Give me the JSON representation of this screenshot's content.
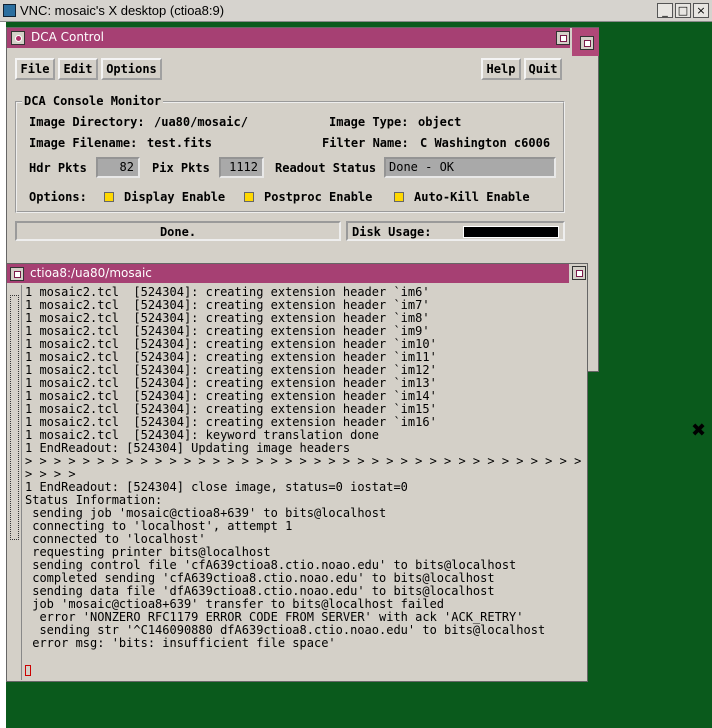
{
  "vnc": {
    "title": "VNC: mosaic's X desktop (ctioa8:9)",
    "minimize": "_",
    "maximize": "□",
    "close": "×"
  },
  "dca": {
    "title": "DCA Control",
    "menu": {
      "file": "File",
      "edit": "Edit",
      "options": "Options"
    },
    "help": "Help",
    "quit": "Quit",
    "monitor_title": "DCA Console Monitor",
    "image_directory_label": "Image Directory:",
    "image_directory": "/ua80/mosaic/",
    "image_type_label": "Image Type:",
    "image_type": "object",
    "image_filename_label": "Image Filename:",
    "image_filename": "test.fits",
    "filter_name_label": "Filter Name:",
    "filter_name": "C Washington c6006",
    "hdr_pkts_label": "Hdr Pkts",
    "hdr_pkts": "82",
    "pix_pkts_label": "Pix Pkts",
    "pix_pkts": "1112",
    "readout_status_label": "Readout Status",
    "readout_status": "Done - OK",
    "options_label": "Options:",
    "display_enable": "Display Enable",
    "postproc_enable": "Postproc Enable",
    "autokill_enable": "Auto-Kill Enable",
    "status": "Done.",
    "disk_usage_label": "Disk Usage:",
    "disk_usage_fraction": 1.0
  },
  "terminal": {
    "title": "ctioa8:/ua80/mosaic",
    "lines": [
      "1 mosaic2.tcl  [524304]: creating extension header `im6'",
      "1 mosaic2.tcl  [524304]: creating extension header `im7'",
      "1 mosaic2.tcl  [524304]: creating extension header `im8'",
      "1 mosaic2.tcl  [524304]: creating extension header `im9'",
      "1 mosaic2.tcl  [524304]: creating extension header `im10'",
      "1 mosaic2.tcl  [524304]: creating extension header `im11'",
      "1 mosaic2.tcl  [524304]: creating extension header `im12'",
      "1 mosaic2.tcl  [524304]: creating extension header `im13'",
      "1 mosaic2.tcl  [524304]: creating extension header `im14'",
      "1 mosaic2.tcl  [524304]: creating extension header `im15'",
      "1 mosaic2.tcl  [524304]: creating extension header `im16'",
      "1 mosaic2.tcl  [524304]: keyword translation done",
      "1 EndReadout: [524304] Updating image headers",
      "> > > > > > > > > > > > > > > > > > > > > > > > > > > > > > > > > > > > > > > > > > > > > > >",
      "> > > >",
      "1 EndReadout: [524304] close image, status=0 iostat=0",
      "Status Information:",
      " sending job 'mosaic@ctioa8+639' to bits@localhost",
      " connecting to 'localhost', attempt 1",
      " connected to 'localhost'",
      " requesting printer bits@localhost",
      " sending control file 'cfA639ctioa8.ctio.noao.edu' to bits@localhost",
      " completed sending 'cfA639ctioa8.ctio.noao.edu' to bits@localhost",
      " sending data file 'dfA639ctioa8.ctio.noao.edu' to bits@localhost",
      " job 'mosaic@ctioa8+639' transfer to bits@localhost failed",
      "  error 'NONZERO RFC1179 ERROR CODE FROM SERVER' with ack 'ACK_RETRY'",
      "  sending str '^C146090880 dfA639ctioa8.ctio.noao.edu' to bits@localhost",
      " error msg: 'bits: insufficient file space'"
    ]
  }
}
